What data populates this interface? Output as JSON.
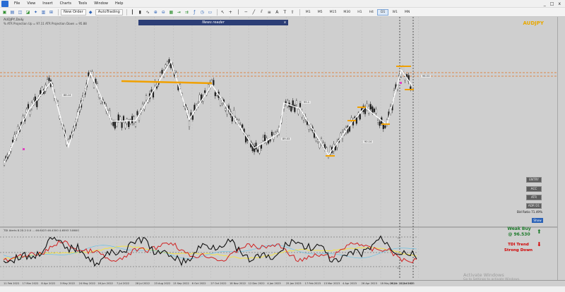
{
  "menu": [
    "File",
    "View",
    "Insert",
    "Charts",
    "Tools",
    "Window",
    "Help"
  ],
  "window_controls": [
    "_",
    "□",
    "x"
  ],
  "toolbar": {
    "new_order": "New Order",
    "autotrading": "AutoTrading",
    "timeframes": [
      "M1",
      "M5",
      "M15",
      "M30",
      "H1",
      "H4",
      "D1",
      "W1",
      "MN"
    ],
    "active_timeframe": "D1"
  },
  "chart": {
    "symbol_line": "AUDJPY,Daily",
    "indicator_line": "% ATR Projection Up = 97.11     ATR Projection Down = 95.88",
    "news_bar": "News reader",
    "news_close": "x",
    "pair_label": "AUDJPY",
    "side_buttons": [
      "ENTRY",
      "ACC",
      "ATR",
      "ADR D1"
    ],
    "bid_ratio": "Bid Ratio 71.49%",
    "show_button": "Show",
    "indicator_label": "TDI Alerts 8.20.2 0.0 ... 46.6423 46.4300 4.6593 3.8600",
    "weak_buy_line1": "Weak Buy",
    "weak_buy_line2": "@ 96.530",
    "tdi_trend": "TDI Trend",
    "strong_down": "Strong Down",
    "arrow_up": "⬆",
    "arrow_down": "⬇",
    "watermark": "Activate Windows",
    "watermark_sub": "Go to Settings to activate Windows.",
    "price_tags": [
      "88.14",
      "95.1",
      "89.03",
      "90.14",
      "96.53"
    ],
    "indicator_levels": [
      "70",
      "50",
      "32"
    ],
    "colors": {
      "background": "#cfcfcf",
      "zigzag": "#ffffff",
      "level": "#f0a000",
      "price_line": "#e07020"
    }
  },
  "time_axis": [
    "11 Feb 2022",
    "17 Mar 2022",
    "8 Apr 2022",
    "3 May 2022",
    "24 May 2022",
    "16 Jun 2022",
    "7 Jul 2022",
    "28 Jul 2022",
    "23 Aug 2022",
    "13 Sep 2022",
    "6 Oct 2022",
    "27 Oct 2022",
    "18 Nov 2022",
    "12 Dec 2022",
    "4 Jan 2023",
    "25 Jan 2023",
    "17 Feb 2023",
    "13 Mar 2023",
    "4 Apr 2023",
    "26 Apr 2023",
    "18 May 2023",
    "12 Jun 2023",
    "26 Jun 2023 03:45"
  ]
}
